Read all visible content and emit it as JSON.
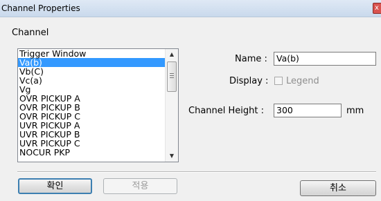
{
  "window": {
    "title": "Channel Properties",
    "close_glyph": "x"
  },
  "channel_section": {
    "label": "Channel"
  },
  "channel_list": {
    "items": [
      "Trigger Window",
      "Va(b)",
      "Vb(C)",
      "Vc(a)",
      "Vg",
      "OVR PICKUP A",
      "OVR PICKUP B",
      "OVR PICKUP C",
      "UVR PICKUP A",
      "UVR PICKUP B",
      "UVR PICKUP C",
      "NOCUR PKP"
    ],
    "selected_index": 1
  },
  "form": {
    "name_label": "Name :",
    "name_value": "Va(b)",
    "display_label": "Display :",
    "legend_label": "Legend",
    "legend_checked": false,
    "height_label": "Channel Height :",
    "height_value": "300",
    "height_unit": "mm"
  },
  "buttons": {
    "ok": "확인",
    "apply": "적용",
    "cancel": "취소"
  }
}
